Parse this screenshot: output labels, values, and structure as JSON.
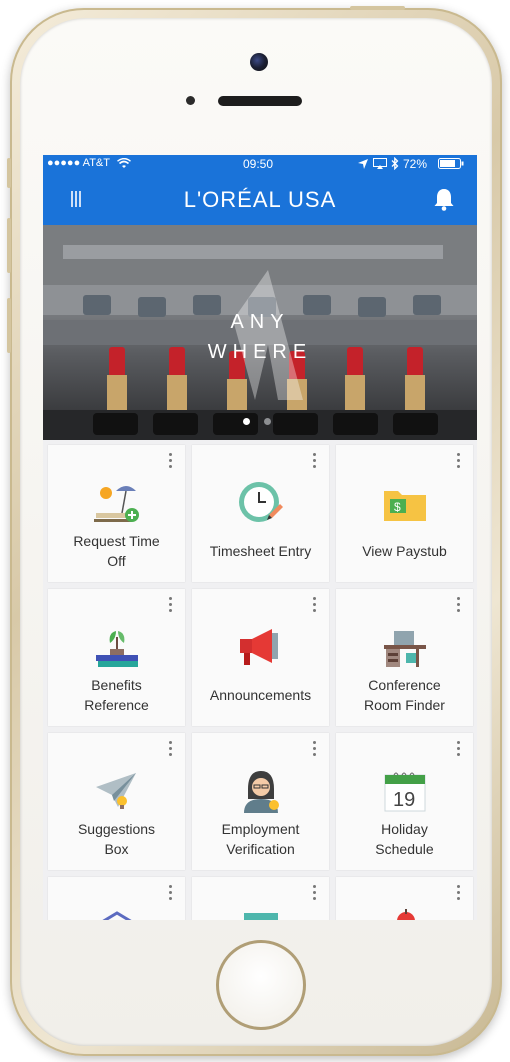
{
  "status": {
    "carrier": "●●●●● AT&T",
    "time": "09:50",
    "battery": "72%"
  },
  "header": {
    "brand": "L'ORÉAL USA",
    "menu_icon": "menu-icon",
    "bell_icon": "bell-icon"
  },
  "hero": {
    "line1": "ANY",
    "line2": "WHERE",
    "active_slide": 1,
    "slide_count": 2
  },
  "tiles": [
    {
      "line1": "Request Time",
      "line2": "Off",
      "icon": "beach-icon"
    },
    {
      "line1": "Timesheet Entry",
      "line2": "",
      "icon": "clock-icon"
    },
    {
      "line1": "View Paystub",
      "line2": "",
      "icon": "folder-dollar-icon"
    },
    {
      "line1": "Benefits",
      "line2": "Reference",
      "icon": "plant-books-icon"
    },
    {
      "line1": "Announcements",
      "line2": "",
      "icon": "megaphone-icon"
    },
    {
      "line1": "Conference",
      "line2": "Room Finder",
      "icon": "desk-icon"
    },
    {
      "line1": "Suggestions",
      "line2": "Box",
      "icon": "paper-plane-icon"
    },
    {
      "line1": "Employment",
      "line2": "Verification",
      "icon": "person-icon"
    },
    {
      "line1": "Holiday",
      "line2": "Schedule",
      "icon": "calendar-icon"
    }
  ],
  "calendar_day": "19",
  "colors": {
    "brand_blue": "#1a73d9",
    "tile_bg": "#fafafa"
  }
}
